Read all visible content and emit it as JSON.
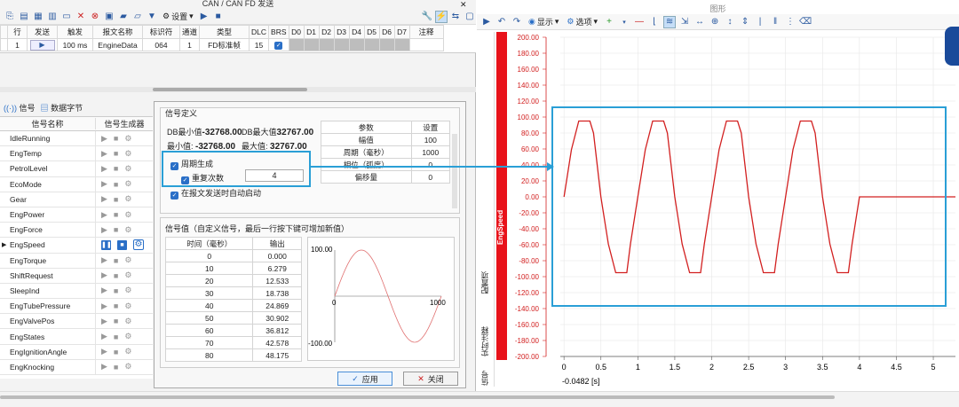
{
  "left_window": {
    "title": "CAN / CAN FD 发送",
    "toolbar": {
      "settings_label": "设置"
    },
    "grid": {
      "headers": [
        "行",
        "发送",
        "触发",
        "报文名称",
        "标识符",
        "通道",
        "类型",
        "DLC",
        "BRS",
        "D0",
        "D1",
        "D2",
        "D3",
        "D4",
        "D5",
        "D6",
        "D7",
        "注释"
      ],
      "row": {
        "row": "1",
        "trigger": "100 ms",
        "name": "EngineData",
        "id": "064",
        "channel": "1",
        "type": "FD标准帧",
        "dlc": "15"
      }
    },
    "tabs": [
      {
        "label": "信号"
      },
      {
        "label": "数据字节"
      }
    ],
    "signal_list": {
      "col_name": "信号名称",
      "col_gen": "信号生成器",
      "items": [
        "IdleRunning",
        "EngTemp",
        "PetrolLevel",
        "EcoMode",
        "Gear",
        "EngPower",
        "EngForce",
        "EngSpeed",
        "EngTorque",
        "ShiftRequest",
        "SleepInd",
        "EngTubePressure",
        "EngValvePos",
        "EngStates",
        "EngIgnitionAngle",
        "EngKnocking"
      ],
      "active": "EngSpeed"
    }
  },
  "dialog": {
    "section_title": "信号定义",
    "db_min_label": "DB最小值",
    "db_min": "-32768.00",
    "db_max_label": "DB最大值",
    "db_max": "32767.00",
    "min_label": "最小值:",
    "min": "-32768.00",
    "max_label": "最大值:",
    "max": "32767.00",
    "periodic_label": "周期生成",
    "repeat_label": "重复次数",
    "repeat_value": "4",
    "autostart_label": "在报文发送时自动启动",
    "params": {
      "header": [
        "参数",
        "设置"
      ],
      "rows": [
        [
          "幅值",
          "100"
        ],
        [
          "周期（毫秒）",
          "1000"
        ],
        [
          "相位（弧度）",
          "0"
        ],
        [
          "偏移量",
          "0"
        ]
      ]
    },
    "values_title": "信号值（自定义信号，最后一行按下键可增加新值）",
    "values_table": {
      "header": [
        "时间（毫秒）",
        "输出"
      ],
      "rows": [
        [
          "0",
          "0.000"
        ],
        [
          "10",
          "6.279"
        ],
        [
          "20",
          "12.533"
        ],
        [
          "30",
          "18.738"
        ],
        [
          "40",
          "24.869"
        ],
        [
          "50",
          "30.902"
        ],
        [
          "60",
          "36.812"
        ],
        [
          "70",
          "42.578"
        ],
        [
          "80",
          "48.175"
        ]
      ]
    },
    "preview": {
      "ymax": "100.00",
      "ymin": "-100.00",
      "x0": "0",
      "x1": "1000"
    },
    "apply_label": "应用",
    "close_label": "关闭"
  },
  "right_window": {
    "title": "图形",
    "display_label": "显示",
    "options_label": "选项",
    "side_tabs": [
      "配置项",
      "实时注释",
      "信号"
    ],
    "signal_name": "EngSpeed",
    "cursor_readout": "-0.0482 [s]"
  },
  "chart_data": {
    "type": "line",
    "ylim": [
      -200,
      200
    ],
    "yticks": [
      "200.00",
      "180.00",
      "160.00",
      "140.00",
      "120.00",
      "100.00",
      "80.00",
      "60.00",
      "40.00",
      "20.00",
      "0.00",
      "-20.00",
      "-40.00",
      "-60.00",
      "-80.00",
      "-100.00",
      "-120.00",
      "-140.00",
      "-160.00",
      "-180.00",
      "-200.00"
    ],
    "xlim": [
      -0.05,
      5.3
    ],
    "xticks": [
      "0",
      "0.5",
      "1",
      "1.5",
      "2",
      "2.5",
      "3",
      "3.5",
      "4",
      "4.5",
      "5"
    ],
    "series": [
      {
        "color": "#d22020",
        "x": [
          0,
          0.1,
          0.2,
          0.25,
          0.3,
          0.35,
          0.4,
          0.5,
          0.6,
          0.7,
          0.75,
          0.8,
          0.85,
          0.9,
          1.0,
          1.1,
          1.2,
          1.25,
          1.3,
          1.35,
          1.4,
          1.5,
          1.6,
          1.7,
          1.75,
          1.8,
          1.85,
          1.9,
          2.0,
          2.1,
          2.2,
          2.25,
          2.3,
          2.35,
          2.4,
          2.5,
          2.6,
          2.7,
          2.75,
          2.8,
          2.85,
          2.9,
          3.0,
          3.1,
          3.2,
          3.25,
          3.3,
          3.35,
          3.4,
          3.5,
          3.6,
          3.7,
          3.75,
          3.8,
          3.85,
          3.9,
          4.0,
          4.5,
          5.0,
          5.3
        ],
        "y": [
          0,
          59,
          95,
          95,
          95,
          95,
          80,
          0,
          -59,
          -95,
          -95,
          -95,
          -95,
          -59,
          0,
          59,
          95,
          95,
          95,
          95,
          80,
          0,
          -59,
          -95,
          -95,
          -95,
          -95,
          -59,
          0,
          59,
          95,
          95,
          95,
          95,
          80,
          0,
          -59,
          -95,
          -95,
          -95,
          -95,
          -59,
          0,
          59,
          95,
          95,
          95,
          95,
          80,
          0,
          -59,
          -95,
          -95,
          -95,
          -95,
          -59,
          0,
          0,
          0,
          0
        ]
      }
    ],
    "preview_series": {
      "color": "#e07070"
    }
  }
}
